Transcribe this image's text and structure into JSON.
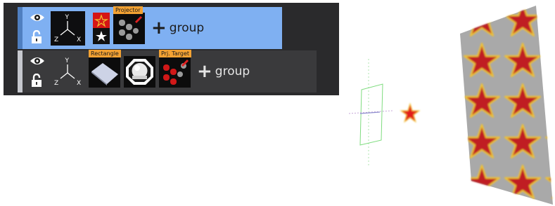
{
  "scene_tree": {
    "rows": [
      {
        "selected": true,
        "tiles": [
          {
            "name": "image",
            "label": ""
          },
          {
            "name": "Projector",
            "label": "Projector"
          }
        ],
        "add_group": {
          "plus": "+",
          "label": "group"
        }
      },
      {
        "selected": false,
        "tiles": [
          {
            "name": "Rectangle",
            "label": "Rectangle"
          },
          {
            "name": "material",
            "label": ""
          },
          {
            "name": "Prj. Target",
            "label": "Prj. Target"
          }
        ],
        "add_group": {
          "plus": "+",
          "label": "group"
        }
      }
    ],
    "axis_labels": {
      "y": "Y",
      "z": "Z",
      "x": "X"
    },
    "icons": {
      "visibility": "eye-icon",
      "lock_open": "unlock-icon",
      "lock_closed": "lock-icon"
    },
    "colors": {
      "selected_row": "#7fb0f2",
      "row": "#3a3a3c",
      "label_badge": "#f3a233"
    }
  },
  "viewport": {
    "objects": [
      "projector-frustum",
      "star-marker",
      "projected-texture-plane"
    ],
    "colors": {
      "star": "#e21b1b",
      "star_outline": "#f2c230",
      "plane_bg": "#a9a9a9",
      "frustum": "#7fdc7f"
    }
  }
}
